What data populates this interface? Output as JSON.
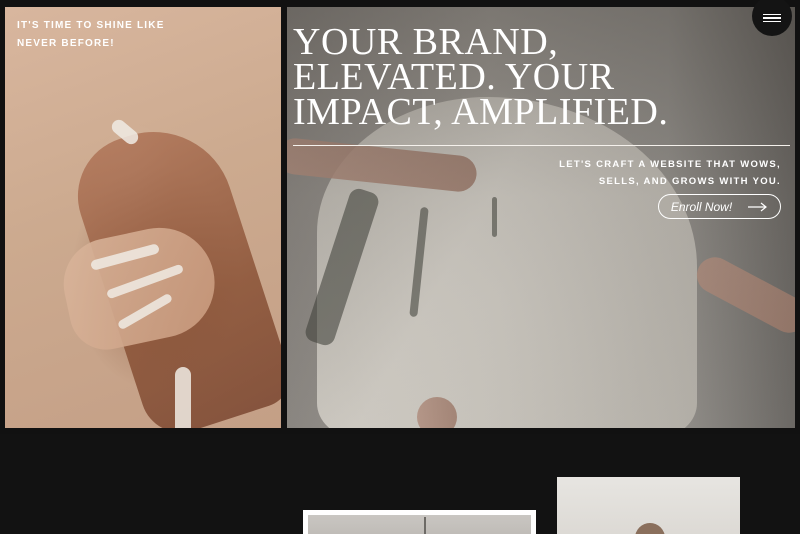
{
  "hero": {
    "tagline": "IT'S TIME TO SHINE LIKE NEVER BEFORE!",
    "headline_line1": "YOUR BRAND,",
    "headline_line2": "ELEVATED. YOUR",
    "headline_line3": "IMPACT, AMPLIFIED.",
    "subtext_line1": "LET'S CRAFT A WEBSITE THAT WOWS,",
    "subtext_line2": "SELLS, AND GROWS WITH YOU.",
    "cta_label": "Enroll Now!"
  },
  "icons": {
    "menu": "hamburger-menu-icon",
    "cta_arrow": "arrow-right-icon"
  },
  "colors": {
    "background": "#111111",
    "text": "#ffffff",
    "menu_button": "#141414"
  }
}
